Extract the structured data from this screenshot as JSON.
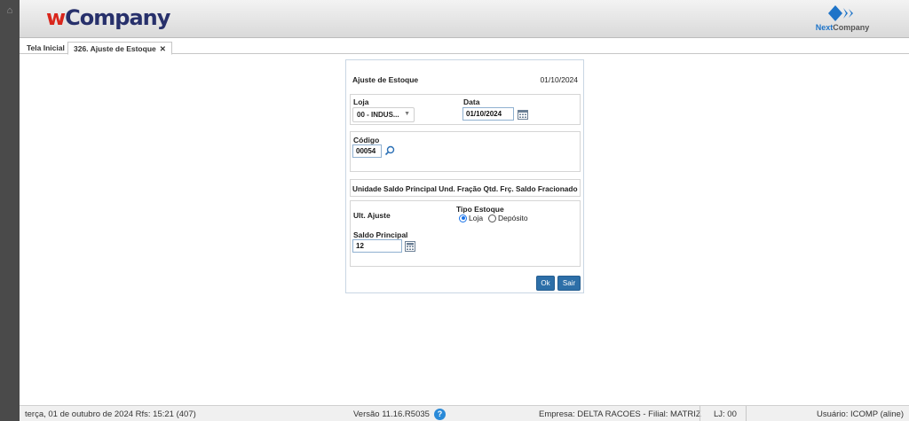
{
  "header": {
    "brand_w": "w",
    "brand_rest": "Company",
    "next_logo_a": "Next",
    "next_logo_b": "Company"
  },
  "tabs": [
    {
      "label": "Tela Inicial"
    },
    {
      "label": "326. Ajuste de Estoque",
      "close": "✕"
    }
  ],
  "dialog": {
    "title": "Ajuste de Estoque",
    "date": "01/10/2024",
    "loja_label": "Loja",
    "loja_value": "00 - INDUS...",
    "data_label": "Data",
    "data_value": "01/10/2024",
    "codigo_label": "Código",
    "codigo_value": "00054",
    "columns": "Unidade  Saldo Principal Und. Fração Qtd. Frç.  Saldo Fracionado",
    "ult_ajuste_label": "Ult. Ajuste",
    "tipo_estoque_label": "Tipo Estoque",
    "radio_loja": "Loja",
    "radio_deposito": "Depósito",
    "selected_radio": "Loja",
    "saldo_label": "Saldo Principal",
    "saldo_value": "12",
    "ok_label": "Ok",
    "sair_label": "Sair"
  },
  "status": {
    "date": "terça, 01 de outubro de 2024  Rfs: 15:21 (407)",
    "version": "Versão 11.16.R5035",
    "help": "?",
    "empresa": "Empresa: DELTA RACOES - Filial: MATRIZ",
    "lj": "LJ: 00",
    "user": "Usuário: ICOMP (aline)"
  },
  "colors": {
    "brand_red": "#d9261c",
    "brand_navy": "#27306b",
    "button_blue": "#2d6fa8",
    "accent_blue": "#1f74c8"
  },
  "icons": {
    "home": "home-icon",
    "search": "search-icon",
    "calendar": "calendar-icon",
    "help": "help-icon",
    "next_logo": "diamond-arrows-logo"
  }
}
